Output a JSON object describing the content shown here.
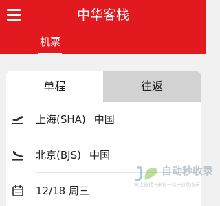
{
  "header": {
    "title": "中华客栈",
    "menu_icon": "hamburger-menu-icon",
    "background_color": "#e21a1f"
  },
  "subnav": {
    "active_tab": "机票"
  },
  "trip_type": {
    "tabs": [
      {
        "label": "单程",
        "selected": true
      },
      {
        "label": "往返",
        "selected": false
      }
    ]
  },
  "form": {
    "departure": {
      "city": "上海(SHA)",
      "country": "中国",
      "icon": "plane-takeoff-icon"
    },
    "arrival": {
      "city": "北京(BJS)",
      "country": "中国",
      "icon": "plane-landing-icon"
    },
    "date": {
      "value": "12/18 周三",
      "icon": "calendar-icon"
    }
  },
  "watermark": {
    "brand": "自动秒收录",
    "slogan": "做上链接→来访一次→自动收录"
  }
}
